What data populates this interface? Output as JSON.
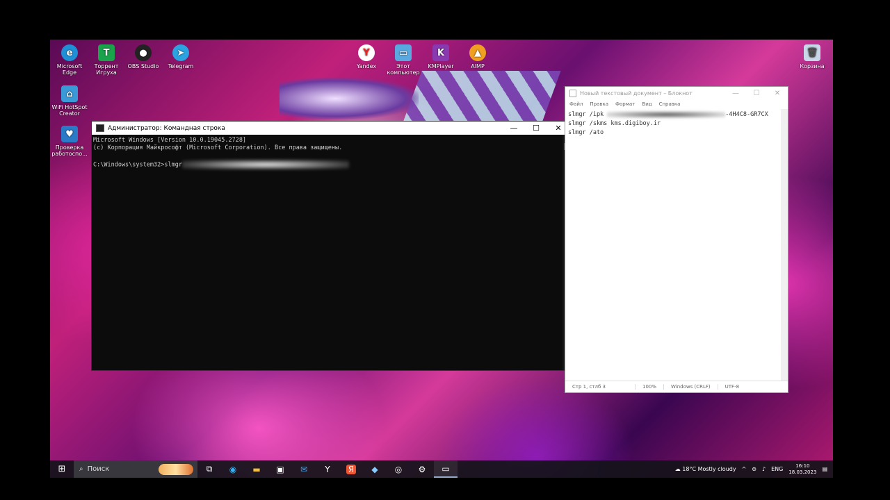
{
  "desktop": {
    "icons": [
      {
        "label": "Microsoft Edge",
        "icon": "edge-icon",
        "color": "#1f8fd6"
      },
      {
        "label": "Торрент Игруха",
        "icon": "torrent-icon",
        "color": "#1aa34a"
      },
      {
        "label": "OBS Studio",
        "icon": "obs-icon",
        "color": "#222222"
      },
      {
        "label": "Telegram",
        "icon": "telegram-icon",
        "color": "#2aa3e0"
      },
      {
        "label": "Yandex",
        "icon": "yandex-icon",
        "color": "#ffffff"
      },
      {
        "label": "Этот компьютер",
        "icon": "computer-icon",
        "color": "#5aa8e0"
      },
      {
        "label": "KMPlayer",
        "icon": "kmplayer-icon",
        "color": "#8a3ab0"
      },
      {
        "label": "AIMP",
        "icon": "aimp-icon",
        "color": "#f0a020"
      },
      {
        "label": "Корзина",
        "icon": "recycle-bin-icon",
        "color": "#c8d8e8"
      },
      {
        "label": "WiFi HotSpot Creator",
        "icon": "wifi-hotspot-icon",
        "color": "#3a9ad8"
      },
      {
        "label": "Проверка работоспо...",
        "icon": "health-check-icon",
        "color": "#2a7ac8"
      }
    ]
  },
  "cmd": {
    "title": "Администратор: Командная строка",
    "line1": "Microsoft Windows [Version 10.0.19045.2728]",
    "line2": "(c) Корпорация Майкрософт (Microsoft Corporation). Все права защищены.",
    "prompt": "C:\\Windows\\system32>slmgr"
  },
  "notepad": {
    "title": "Новый текстовый документ – Блокнот",
    "menu": [
      "Файл",
      "Правка",
      "Формат",
      "Вид",
      "Справка"
    ],
    "line1_prefix": "slmgr /ipk ",
    "line1_suffix": "-4H4C8-GR7CX",
    "line2": "slmgr /skms kms.digiboy.ir",
    "line3": "slmgr /ato",
    "status": {
      "position": "Стр 1, стлб 3",
      "zoom": "100%",
      "eol": "Windows (CRLF)",
      "encoding": "UTF-8"
    }
  },
  "taskbar": {
    "search_label": "Поиск",
    "weather": "18°C  Mostly cloudy",
    "lang": "ENG",
    "time": "16:10",
    "date": "18.03.2023"
  }
}
